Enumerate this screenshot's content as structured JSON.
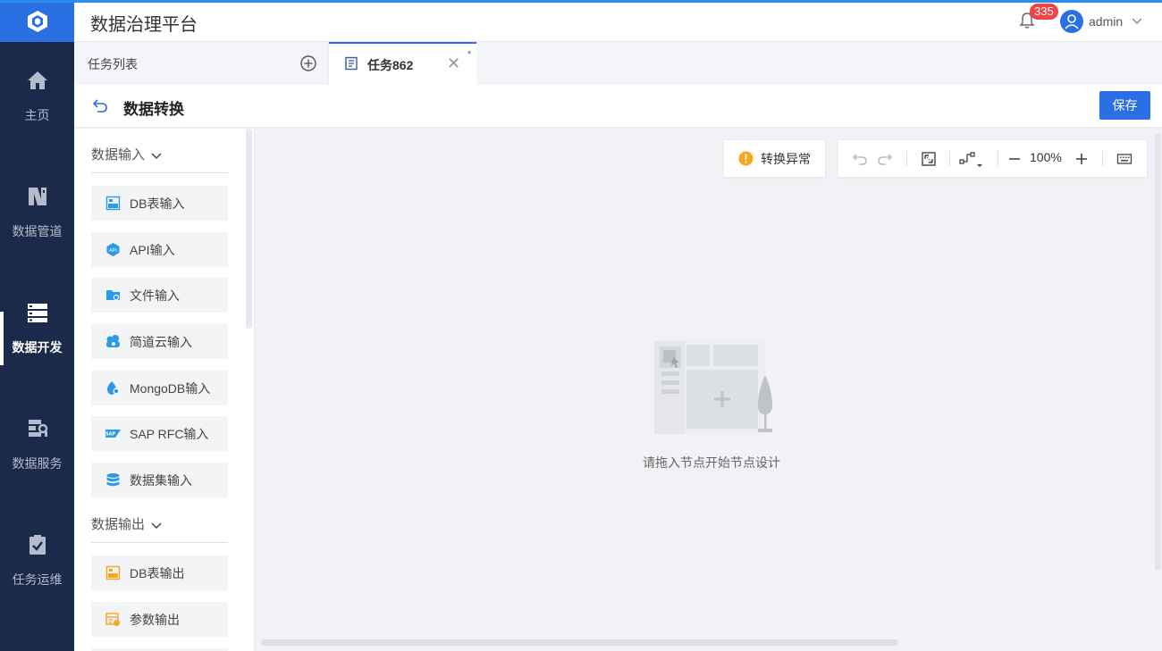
{
  "app": {
    "title": "数据治理平台"
  },
  "nav": {
    "items": [
      {
        "label": "主页",
        "icon": "home-icon"
      },
      {
        "label": "数据管道",
        "icon": "pipeline-icon"
      },
      {
        "label": "数据开发",
        "icon": "server-icon",
        "active": true
      },
      {
        "label": "数据服务",
        "icon": "service-icon"
      },
      {
        "label": "任务运维",
        "icon": "clipboard-check-icon"
      }
    ]
  },
  "header": {
    "notification_count": "335",
    "user_name": "admin"
  },
  "tabs": {
    "list_label": "任务列表",
    "active_label": "任务862",
    "close_glyph": "✕",
    "modified_marker": "*"
  },
  "subheader": {
    "title": "数据转换",
    "save_label": "保存"
  },
  "panel": {
    "groups": [
      {
        "label": "数据输入",
        "items": [
          {
            "label": "DB表输入",
            "icon": "db-table-icon"
          },
          {
            "label": "API输入",
            "icon": "api-icon"
          },
          {
            "label": "文件输入",
            "icon": "folder-icon"
          },
          {
            "label": "简道云输入",
            "icon": "jiandaoyun-icon"
          },
          {
            "label": "MongoDB输入",
            "icon": "mongodb-icon"
          },
          {
            "label": "SAP RFC输入",
            "icon": "sap-icon"
          },
          {
            "label": "数据集输入",
            "icon": "database-icon"
          }
        ]
      },
      {
        "label": "数据输出",
        "items": [
          {
            "label": "DB表输出",
            "icon": "db-output-icon"
          },
          {
            "label": "参数输出",
            "icon": "param-output-icon"
          }
        ]
      }
    ]
  },
  "canvas": {
    "warning_label": "转换异常",
    "zoom": "100%",
    "empty_hint": "请拖入节点开始节点设计"
  },
  "colors": {
    "accent": "#2b6fe5",
    "nav_bg": "#1b2a4a",
    "warning": "#f5a623",
    "badge": "#ef4444"
  }
}
